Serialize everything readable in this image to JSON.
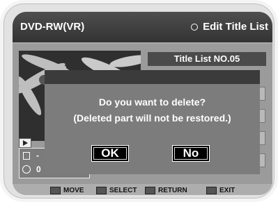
{
  "header": {
    "disc": "DVD-RW(VR)",
    "menu_title": "Edit Title List"
  },
  "list": {
    "title": "Title List NO.05"
  },
  "info": {
    "line1": "-",
    "line2": "0"
  },
  "dialog": {
    "message1": "Do you want to delete?",
    "message2": "(Deleted part will not be restored.)",
    "ok": "OK",
    "no": "No"
  },
  "footer": {
    "move": "MOVE",
    "select": "SELECT",
    "return": "RETURN",
    "exit": "EXIT"
  }
}
